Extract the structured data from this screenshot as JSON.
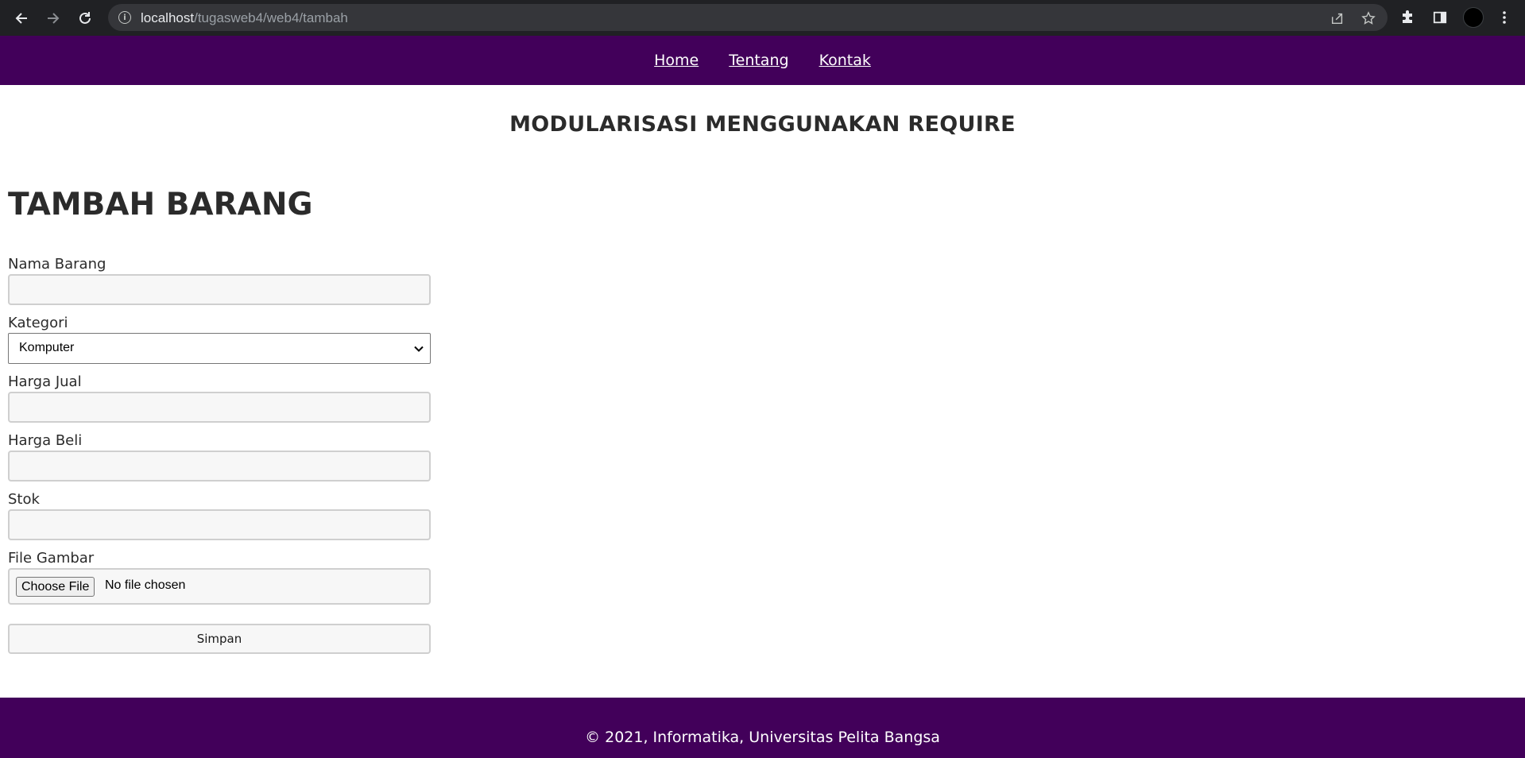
{
  "browser": {
    "url_host": "localhost",
    "url_path": "/tugasweb4/web4/tambah",
    "icons": [
      "back-icon",
      "forward-icon",
      "reload-icon",
      "site-info-icon",
      "share-icon",
      "star-icon",
      "extensions-icon",
      "side-panel-icon",
      "profile-avatar",
      "menu-icon"
    ]
  },
  "nav": {
    "home": "Home",
    "about": "Tentang",
    "contact": "Kontak"
  },
  "header": {
    "subtitle": "MODULARISASI MENGGUNAKAN REQUIRE"
  },
  "form": {
    "title": "TAMBAH BARANG",
    "nama_label": "Nama Barang",
    "nama_value": "",
    "kategori_label": "Kategori",
    "kategori_value": "Komputer",
    "harga_jual_label": "Harga Jual",
    "harga_jual_value": "",
    "harga_beli_label": "Harga Beli",
    "harga_beli_value": "",
    "stok_label": "Stok",
    "stok_value": "",
    "file_label": "File Gambar",
    "file_button": "Choose File",
    "file_status": "No file chosen",
    "submit": "Simpan"
  },
  "footer": {
    "text": "© 2021, Informatika, Universitas Pelita Bangsa"
  },
  "colors": {
    "nav_background": "#42005a",
    "footer_background": "#42005a",
    "browser_bar": "#202124",
    "text": "#2b2b2b"
  }
}
